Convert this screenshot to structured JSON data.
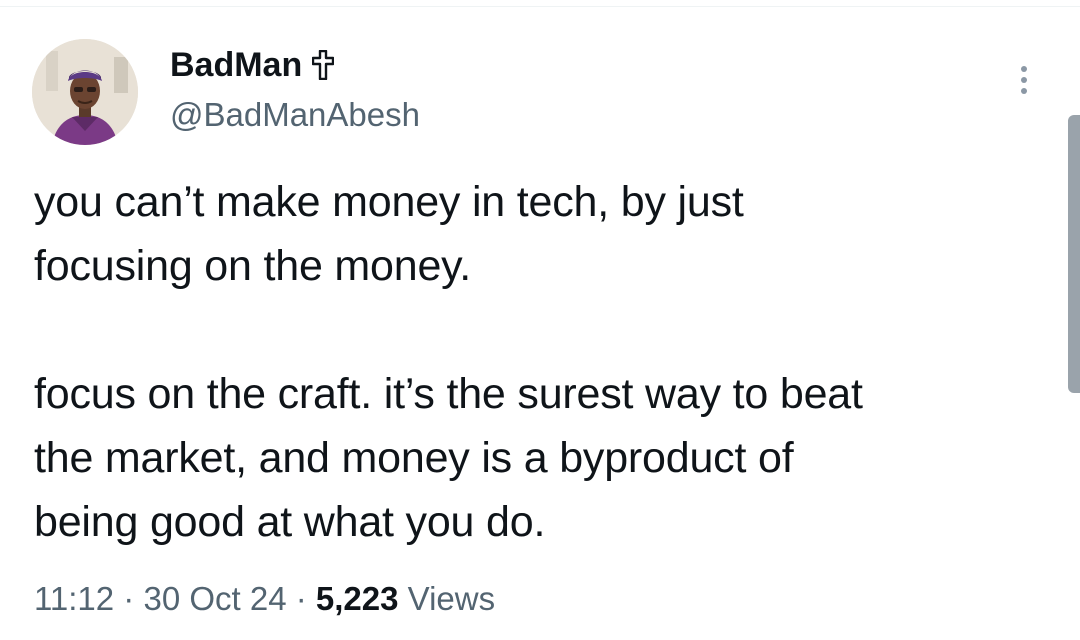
{
  "author": {
    "display_name": "BadMan",
    "handle": "@BadManAbesh",
    "avatar_icon": "profile-photo",
    "badge_icon": "cross-icon"
  },
  "tweet": {
    "text": "you can’t make money in tech, by just\nfocusing on the money.\n\nfocus on the craft. it’s the surest way to beat\nthe market, and money is a byproduct of\nbeing good at what you do."
  },
  "meta": {
    "time": "11:12",
    "separator": " · ",
    "date": "30 Oct 24",
    "views_count": "5,223",
    "views_label": "Views"
  },
  "more_icon": "more-vertical-icon",
  "colors": {
    "text_primary": "#0f1419",
    "text_secondary": "#536471",
    "background": "#ffffff"
  }
}
